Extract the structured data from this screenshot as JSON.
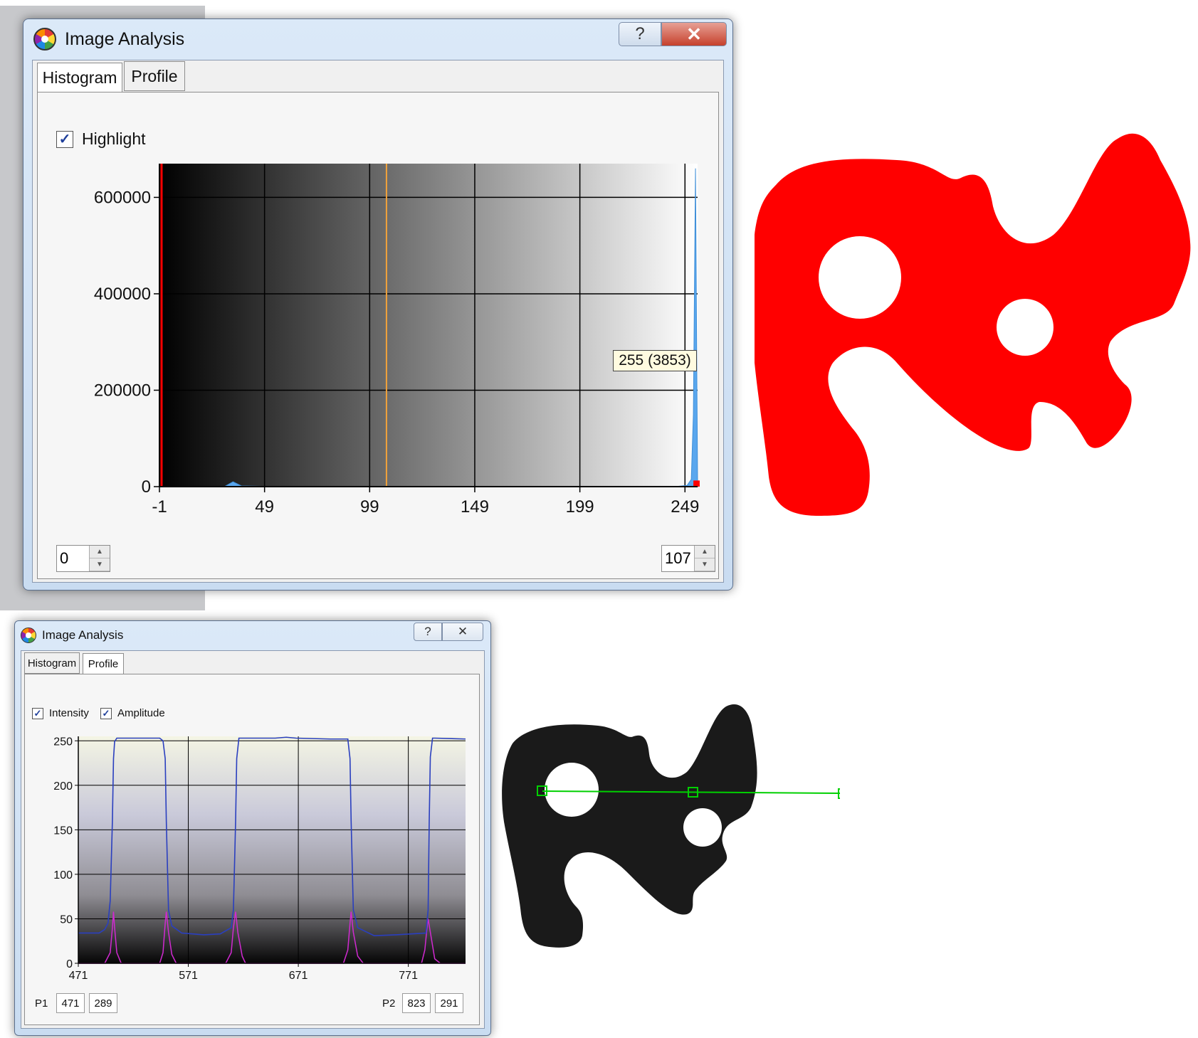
{
  "histogram_window": {
    "title": "Image Analysis",
    "help_button": "?",
    "close_button": "✕",
    "tabs": [
      {
        "label": "Histogram",
        "active": true
      },
      {
        "label": "Profile",
        "active": false
      }
    ],
    "highlight": {
      "label": "Highlight",
      "checked": true
    },
    "low_threshold": "0",
    "high_threshold": "107",
    "tooltip": "255 (3853)"
  },
  "profile_window": {
    "title": "Image Analysis",
    "help_button": "?",
    "close_button": "✕",
    "tabs": [
      {
        "label": "Histogram",
        "active": false
      },
      {
        "label": "Profile",
        "active": true
      }
    ],
    "intensity": {
      "label": "Intensity",
      "checked": true
    },
    "amplitude": {
      "label": "Amplitude",
      "checked": true
    },
    "p1": {
      "label": "P1",
      "x": "471",
      "y": "289"
    },
    "p2": {
      "label": "P2",
      "x": "823",
      "y": "291"
    }
  },
  "colors": {
    "highlight_red": "#ff0000",
    "histogram_line": "#5aa7ee",
    "threshold_marker": "#f2a23a",
    "intensity_line": "#2a3fbf",
    "amplitude_line": "#d12ad1",
    "profile_line": "#00d000"
  },
  "chart_data": [
    {
      "type": "area",
      "chart": "histogram",
      "xlim": [
        -1,
        255
      ],
      "ylim": [
        0,
        670000
      ],
      "xticks": [
        "-1",
        "49",
        "99",
        "149",
        "199",
        "249"
      ],
      "yticks": [
        "0",
        "200000",
        "400000",
        "600000"
      ],
      "threshold_low": 0,
      "threshold_high": 107,
      "points": [
        [
          0,
          0
        ],
        [
          30,
          300
        ],
        [
          34,
          10000
        ],
        [
          38,
          1500
        ],
        [
          50,
          600
        ],
        [
          100,
          400
        ],
        [
          150,
          300
        ],
        [
          200,
          200
        ],
        [
          245,
          400
        ],
        [
          250,
          2500
        ],
        [
          252,
          15000
        ],
        [
          253,
          150000
        ],
        [
          254,
          660000
        ],
        [
          255,
          3853
        ]
      ],
      "grid": true
    },
    {
      "type": "line",
      "chart": "profile",
      "xlim": [
        471,
        823
      ],
      "ylim": [
        0,
        255
      ],
      "xticks": [
        "471",
        "571",
        "671",
        "771"
      ],
      "yticks": [
        "0",
        "50",
        "100",
        "150",
        "200",
        "250"
      ],
      "series": [
        {
          "label": "Intensity",
          "points": [
            [
              471,
              34
            ],
            [
              490,
              34
            ],
            [
              495,
              38
            ],
            [
              498,
              45
            ],
            [
              500,
              70
            ],
            [
              502,
              160
            ],
            [
              503,
              230
            ],
            [
              504,
              249
            ],
            [
              506,
              253
            ],
            [
              515,
              253
            ],
            [
              530,
              253
            ],
            [
              545,
              253
            ],
            [
              548,
              250
            ],
            [
              550,
              230
            ],
            [
              551,
              160
            ],
            [
              553,
              60
            ],
            [
              556,
              42
            ],
            [
              565,
              34
            ],
            [
              585,
              32
            ],
            [
              600,
              33
            ],
            [
              610,
              40
            ],
            [
              612,
              60
            ],
            [
              614,
              160
            ],
            [
              615,
              230
            ],
            [
              617,
              253
            ],
            [
              630,
              253
            ],
            [
              650,
              253
            ],
            [
              660,
              254
            ],
            [
              669,
              253
            ],
            [
              700,
              252
            ],
            [
              716,
              252
            ],
            [
              718,
              230
            ],
            [
              719,
              160
            ],
            [
              721,
              60
            ],
            [
              725,
              40
            ],
            [
              740,
              31
            ],
            [
              760,
              32
            ],
            [
              787,
              34
            ],
            [
              789,
              60
            ],
            [
              790,
              160
            ],
            [
              791,
              232
            ],
            [
              793,
              253
            ],
            [
              795,
              253
            ],
            [
              823,
              252
            ]
          ]
        },
        {
          "label": "Amplitude",
          "points": [
            [
              471,
              0
            ],
            [
              495,
              0
            ],
            [
              500,
              12
            ],
            [
              502,
              40
            ],
            [
              503,
              58
            ],
            [
              504,
              40
            ],
            [
              506,
              12
            ],
            [
              510,
              0
            ],
            [
              545,
              0
            ],
            [
              548,
              12
            ],
            [
              550,
              45
            ],
            [
              551,
              58
            ],
            [
              553,
              35
            ],
            [
              556,
              10
            ],
            [
              560,
              0
            ],
            [
              605,
              0
            ],
            [
              610,
              12
            ],
            [
              612,
              40
            ],
            [
              614,
              58
            ],
            [
              616,
              35
            ],
            [
              620,
              8
            ],
            [
              623,
              0
            ],
            [
              712,
              0
            ],
            [
              716,
              15
            ],
            [
              718,
              45
            ],
            [
              719,
              58
            ],
            [
              721,
              35
            ],
            [
              725,
              8
            ],
            [
              730,
              0
            ],
            [
              783,
              0
            ],
            [
              786,
              15
            ],
            [
              788,
              40
            ],
            [
              789,
              50
            ],
            [
              791,
              35
            ],
            [
              795,
              5
            ],
            [
              800,
              0
            ],
            [
              823,
              0
            ]
          ]
        }
      ],
      "grid": true
    }
  ]
}
